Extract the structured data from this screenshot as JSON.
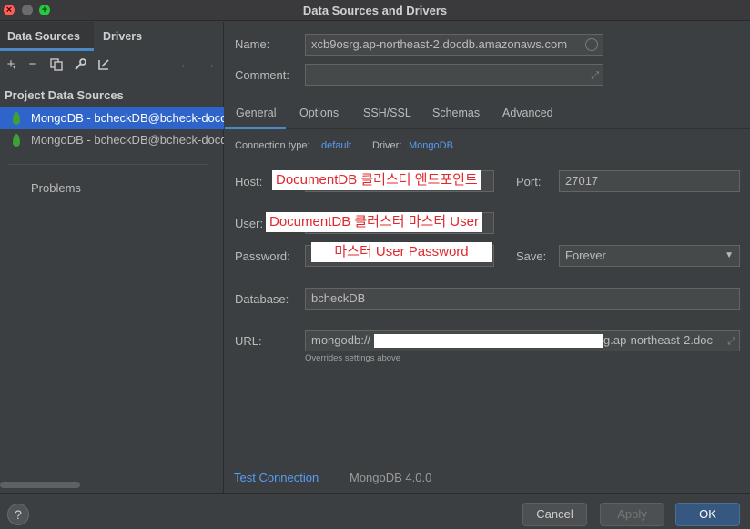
{
  "window": {
    "title": "Data Sources and Drivers"
  },
  "left": {
    "tabs": [
      "Data Sources",
      "Drivers"
    ],
    "toolbar_icons": [
      "add-icon",
      "remove-icon",
      "duplicate-icon",
      "wrench-icon",
      "make-global-icon",
      "back-arrow-icon",
      "forward-arrow-icon"
    ],
    "section_title": "Project Data Sources",
    "items": [
      {
        "label": "MongoDB - bcheckDB@bcheck-docdb",
        "selected": true
      },
      {
        "label": "MongoDB - bcheckDB@bcheck-docdb",
        "selected": false
      }
    ],
    "problems": "Problems"
  },
  "form": {
    "name_label": "Name:",
    "name_value": "xcb9osrg.ap-northeast-2.docdb.amazonaws.com",
    "comment_label": "Comment:",
    "comment_value": "",
    "tabs": [
      "General",
      "Options",
      "SSH/SSL",
      "Schemas",
      "Advanced"
    ],
    "conn_type_label": "Connection type:",
    "conn_type_value": "default",
    "driver_label": "Driver:",
    "driver_value": "MongoDB",
    "host_label": "Host:",
    "host_value": "DocumentDB 클러스터 엔드포인트",
    "port_label": "Port:",
    "port_value": "27017",
    "user_label": "User:",
    "user_value": "DocumentDB 클러스터 마스터 User",
    "password_label": "Password:",
    "password_value": "마스터 User Password",
    "save_label": "Save:",
    "save_value": "Forever",
    "database_label": "Database:",
    "database_value": "bcheckDB",
    "url_label": "URL:",
    "url_prefix": "mongodb://",
    "url_suffix": "g.ap-northeast-2.doc",
    "url_note": "Overrides settings above",
    "test_connection": "Test Connection",
    "server_version": "MongoDB 4.0.0"
  },
  "buttons": {
    "help": "?",
    "cancel": "Cancel",
    "apply": "Apply",
    "ok": "OK"
  },
  "colors": {
    "accent": "#4a88c7",
    "selection": "#2f65ca",
    "link": "#589df6",
    "annotation": "#e0282c"
  }
}
